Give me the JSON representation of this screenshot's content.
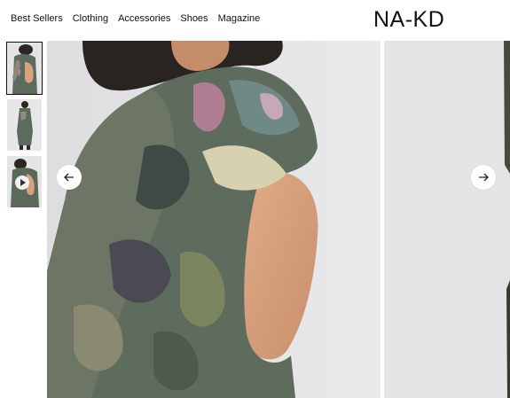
{
  "nav": {
    "links": [
      "Best Sellers",
      "Clothing",
      "Accessories",
      "Shoes",
      "Magazine"
    ]
  },
  "brand": {
    "logo_text": "NA-KD"
  },
  "gallery": {
    "thumbnails": [
      {
        "icon": "photo-back-view",
        "active": true
      },
      {
        "icon": "photo-full-body",
        "active": false
      },
      {
        "icon": "video-play-icon",
        "active": false
      }
    ],
    "prev_icon": "arrow-left-icon",
    "next_icon": "arrow-right-icon"
  },
  "colors": {
    "background": "#ffffff",
    "image_bg": "#e6e6e8",
    "dress_green": "#5b6b5c",
    "skin": "#d9a27e",
    "text": "#111111"
  }
}
